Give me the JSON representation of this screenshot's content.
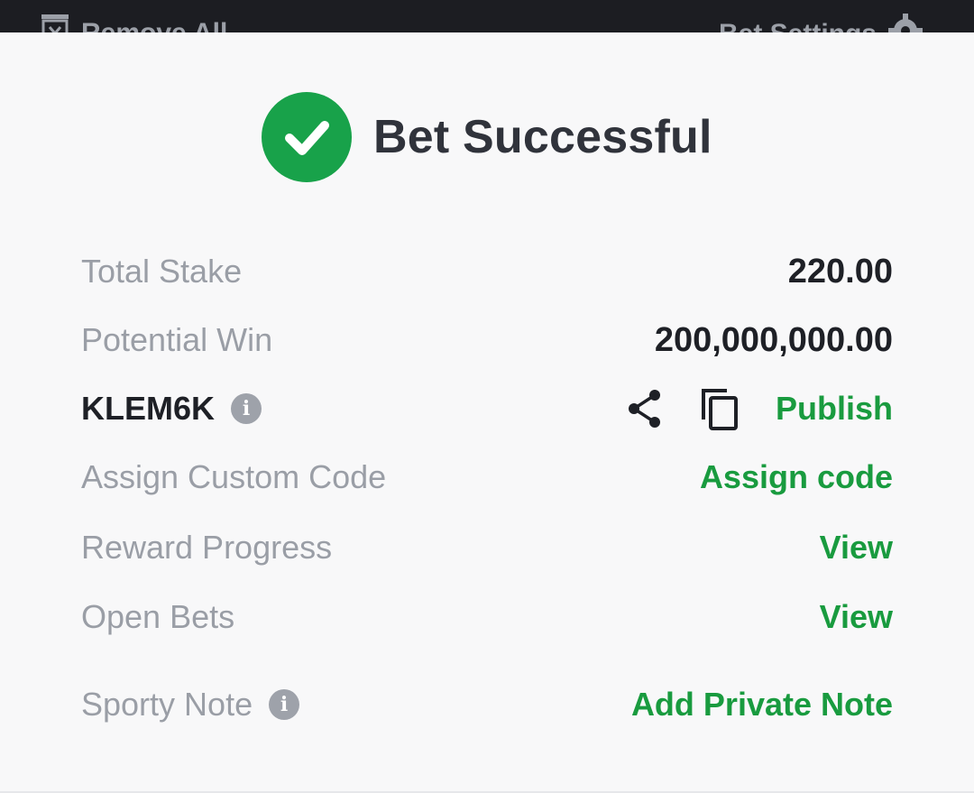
{
  "topbar": {
    "remove_all_label": "Remove All",
    "bet_settings_label": "Bet Settings"
  },
  "header": {
    "title": "Bet Successful"
  },
  "rows": {
    "total_stake": {
      "label": "Total Stake",
      "value": "220.00"
    },
    "potential_win": {
      "label": "Potential Win",
      "value": "200,000,000.00"
    },
    "booking": {
      "code": "KLEM6K",
      "publish_label": "Publish"
    },
    "custom_code": {
      "label": "Assign Custom Code",
      "action": "Assign code"
    },
    "reward_progress": {
      "label": "Reward Progress",
      "action": "View"
    },
    "open_bets": {
      "label": "Open Bets",
      "action": "View"
    },
    "sporty_note": {
      "label": "Sporty Note",
      "action": "Add Private Note"
    }
  },
  "colors": {
    "accent_green": "#199b3f",
    "success_circle": "#18a24a",
    "muted_text": "#9a9ea6",
    "dark_text": "#1e2026"
  },
  "icons": [
    "trash-icon",
    "gear-icon",
    "check-icon",
    "info-icon",
    "share-icon",
    "copy-icon"
  ]
}
